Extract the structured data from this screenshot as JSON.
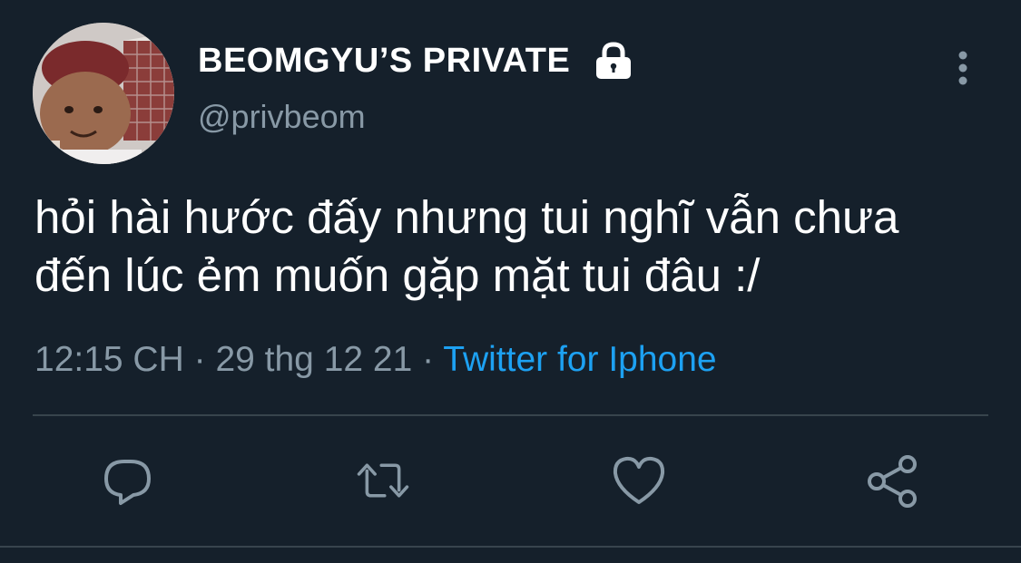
{
  "tweet": {
    "display_name": "BEOMGYU’S PRIVATE",
    "handle": "@privbeom",
    "text_line1": "hỏi hài hước đấy nhưng tui nghĩ vẫn chưa",
    "text_line2": "đến lúc ẻm muốn gặp mặt tui đâu :/",
    "time": "12:15 CH",
    "separator": "·",
    "date": "29 thg 12 21",
    "source": "Twitter for Iphone",
    "protected_icon": "lock-icon",
    "more_icon": "more-vertical-icon"
  },
  "actions": [
    {
      "name": "reply",
      "icon": "reply-icon"
    },
    {
      "name": "retweet",
      "icon": "retweet-icon"
    },
    {
      "name": "like",
      "icon": "heart-icon"
    },
    {
      "name": "share",
      "icon": "share-icon"
    }
  ],
  "colors": {
    "background": "#15202b",
    "primary_text": "#ffffff",
    "secondary_text": "#8899a6",
    "link": "#1da1f2",
    "divider": "#38444d"
  }
}
